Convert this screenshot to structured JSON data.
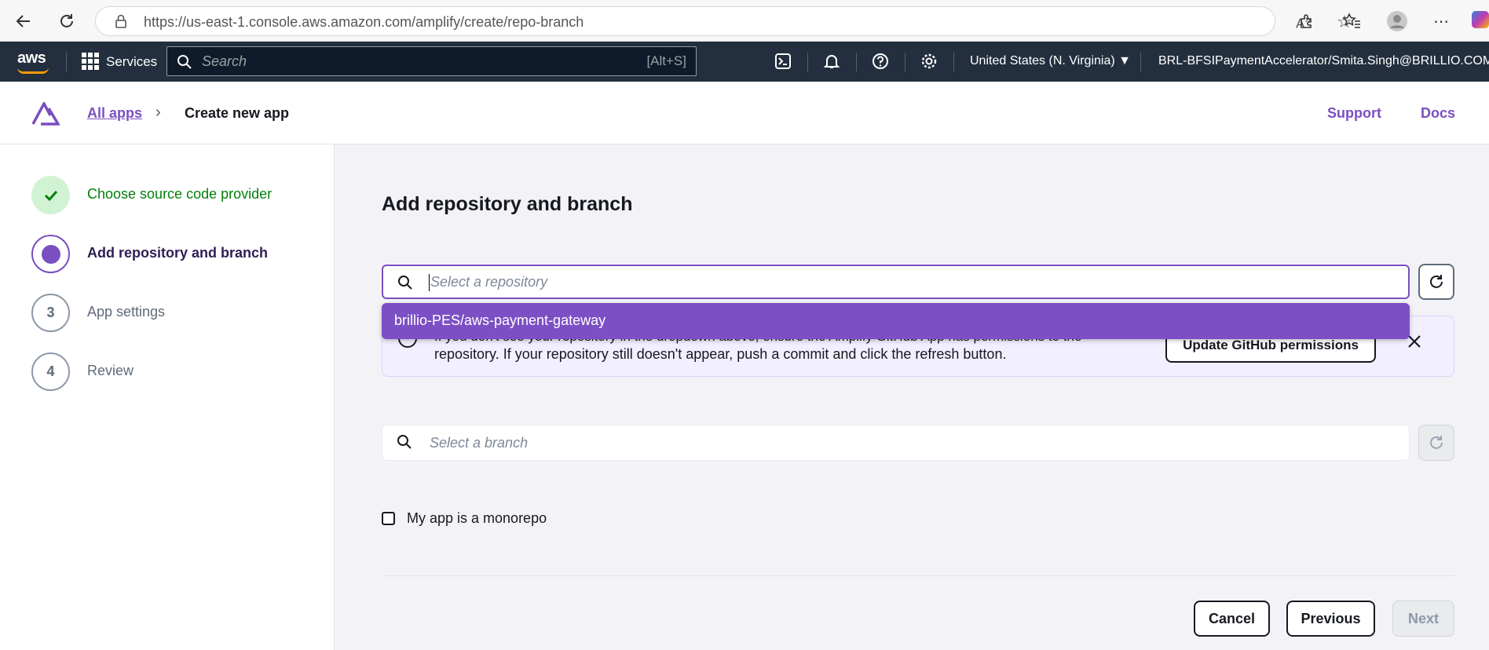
{
  "browser": {
    "url": "https://us-east-1.console.aws.amazon.com/amplify/create/repo-branch"
  },
  "aws_nav": {
    "logo": "aws",
    "services_label": "Services",
    "search_placeholder": "Search",
    "search_shortcut": "[Alt+S]",
    "region": "United States (N. Virginia) ▼",
    "account": "BRL-BFSIPaymentAccelerator/Smita.Singh@BRILLIO.COM ▼"
  },
  "amplify_header": {
    "breadcrumb_all": "All apps",
    "breadcrumb_sep": "›",
    "breadcrumb_current": "Create new app",
    "support": "Support",
    "docs": "Docs"
  },
  "steps": [
    {
      "marker": "✓",
      "label": "Choose source code provider",
      "state": "done"
    },
    {
      "marker": "",
      "label": "Add repository and branch",
      "state": "current"
    },
    {
      "marker": "3",
      "label": "App settings",
      "state": "pending"
    },
    {
      "marker": "4",
      "label": "Review",
      "state": "pending"
    }
  ],
  "main": {
    "title": "Add repository and branch",
    "repo_placeholder": "Select a repository",
    "dropdown_option": "brillio-PES/aws-payment-gateway",
    "info_line1": "If you don't see your repository in the dropdown above, ensure the Amplify GitHub App has permissions to the",
    "info_line2": "repository. If your repository still doesn't appear, push a commit and click the refresh button.",
    "update_github": "Update GitHub permissions",
    "branch_placeholder": "Select a branch",
    "monorepo_label": "My app is a monorepo",
    "cancel": "Cancel",
    "previous": "Previous",
    "next": "Next"
  },
  "colors": {
    "accent": "#7a4fc0",
    "nav_bg": "#232f3e",
    "success": "#037f0c"
  }
}
